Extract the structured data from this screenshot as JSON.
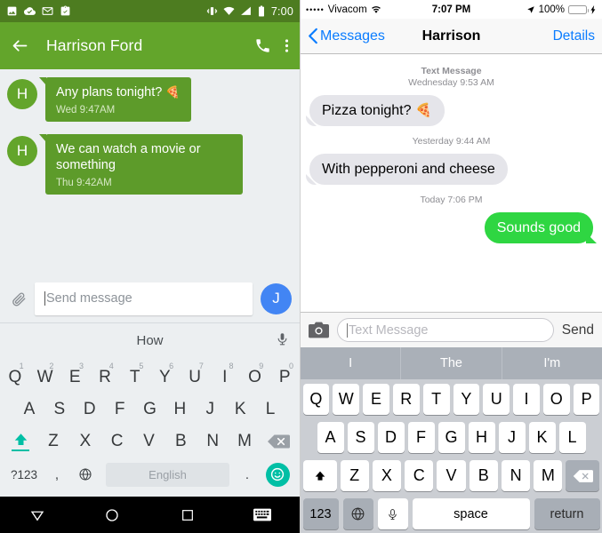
{
  "android": {
    "status_bar": {
      "icons": [
        "image-icon",
        "cloud-check-icon",
        "gmail-icon",
        "clipboard-icon"
      ],
      "right_icons": [
        "vibrate-icon",
        "wifi-icon",
        "signal-icon",
        "battery-icon"
      ],
      "time": "7:00",
      "bg_color": "#4d7c20"
    },
    "app_bar": {
      "back_label": "back-arrow",
      "title": "Harrison Ford",
      "call_label": "call",
      "overflow_label": "more-options",
      "bg_color": "#63a52b"
    },
    "messages": [
      {
        "avatar": "H",
        "text": "Any plans tonight?",
        "emoji": "🍕",
        "time": "Wed 9:47AM"
      },
      {
        "avatar": "H",
        "text": "We can watch a movie or something",
        "emoji": "",
        "time": "Thu 9:42AM"
      }
    ],
    "compose": {
      "attach_label": "attach",
      "placeholder": "Send message",
      "send_avatar": "J",
      "send_color": "#4285f4"
    },
    "suggestion_bar": {
      "word": "How",
      "mic_label": "voice-input"
    },
    "keyboard": {
      "row1": [
        {
          "k": "Q",
          "n": "1"
        },
        {
          "k": "W",
          "n": "2"
        },
        {
          "k": "E",
          "n": "3"
        },
        {
          "k": "R",
          "n": "4"
        },
        {
          "k": "T",
          "n": "5"
        },
        {
          "k": "Y",
          "n": "6"
        },
        {
          "k": "U",
          "n": "7"
        },
        {
          "k": "I",
          "n": "8"
        },
        {
          "k": "O",
          "n": "9"
        },
        {
          "k": "P",
          "n": "0"
        }
      ],
      "row2": [
        "A",
        "S",
        "D",
        "F",
        "G",
        "H",
        "J",
        "K",
        "L"
      ],
      "row3": [
        "Z",
        "X",
        "C",
        "V",
        "B",
        "N",
        "M"
      ],
      "symbols_key": "?123",
      "comma_key": ",",
      "space_label": "English",
      "period_key": ".",
      "shift_label": "shift",
      "delete_label": "backspace",
      "globe_label": "language",
      "emoji_label": "emoji",
      "accent_color": "#00bfa5"
    },
    "nav_bar": {
      "buttons": [
        "back-triangle",
        "home-circle",
        "recents-square",
        "keyboard-toggle"
      ]
    }
  },
  "ios": {
    "status_bar": {
      "signal_dots": "•••••",
      "carrier": "Vivacom",
      "wifi_label": "wifi",
      "time": "7:07 PM",
      "location_label": "location-arrow",
      "battery_percent": "100%",
      "charging_label": "charging-bolt",
      "battery_color": "#4cd964"
    },
    "nav_bar": {
      "back_label": "Messages",
      "title": "Harrison",
      "details_label": "Details",
      "tint_color": "#0a7cff"
    },
    "thread": [
      {
        "kind": "stamp",
        "line1": "Text Message",
        "line2": "Wednesday 9:53 AM"
      },
      {
        "kind": "incoming",
        "text": "Pizza tonight?",
        "emoji": "🍕"
      },
      {
        "kind": "stamp",
        "line1": "",
        "line2": "Yesterday 9:44 AM"
      },
      {
        "kind": "incoming",
        "text": "With pepperoni and cheese",
        "emoji": ""
      },
      {
        "kind": "stamp",
        "line1": "",
        "line2": "Today 7:06 PM"
      },
      {
        "kind": "outgoing",
        "text": "Sounds good",
        "emoji": ""
      }
    ],
    "compose": {
      "camera_label": "camera",
      "placeholder": "Text Message",
      "send_label": "Send"
    },
    "predictive": [
      "I",
      "The",
      "I'm"
    ],
    "keyboard": {
      "row1": [
        "Q",
        "W",
        "E",
        "R",
        "T",
        "Y",
        "U",
        "I",
        "O",
        "P"
      ],
      "row2": [
        "A",
        "S",
        "D",
        "F",
        "G",
        "H",
        "J",
        "K",
        "L"
      ],
      "row3": [
        "Z",
        "X",
        "C",
        "V",
        "B",
        "N",
        "M"
      ],
      "shift_label": "shift",
      "delete_label": "backspace",
      "numbers_key": "123",
      "globe_label": "globe",
      "mic_label": "dictation",
      "space_key": "space",
      "return_key": "return"
    }
  }
}
